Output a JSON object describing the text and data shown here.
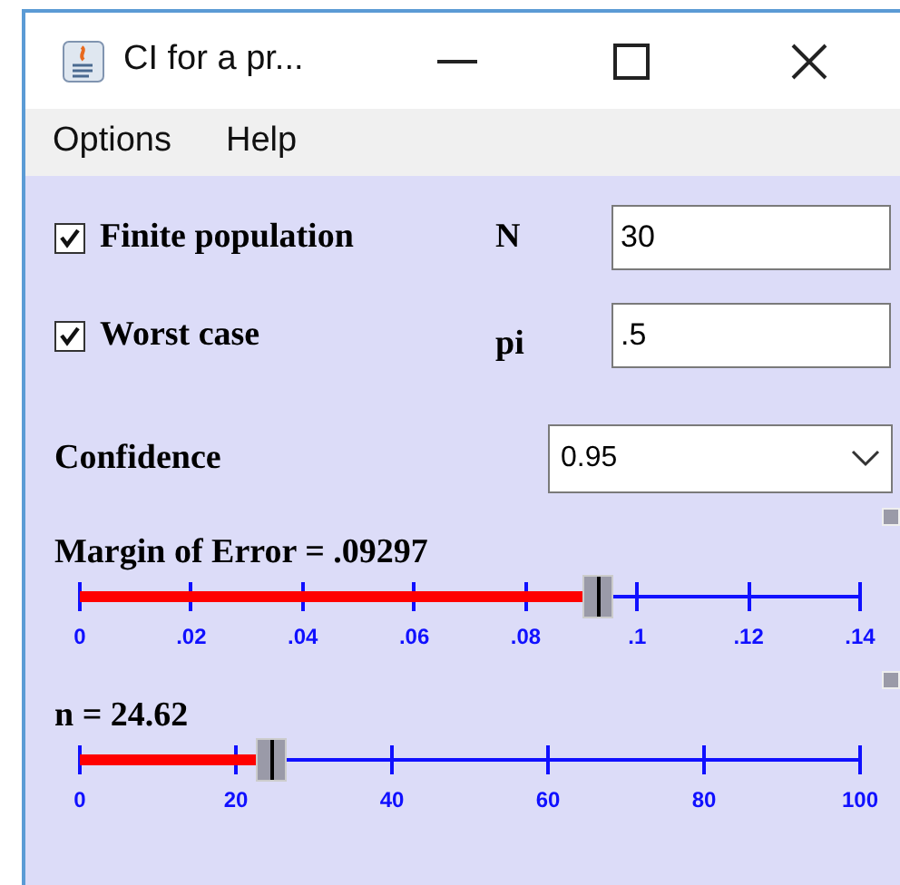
{
  "window": {
    "title": "CI for a pr..."
  },
  "menu": [
    "Options",
    "Help"
  ],
  "options": [
    {
      "label": "Finite population",
      "checked": true,
      "field_label": "N",
      "value": "30"
    },
    {
      "label": "Worst case",
      "checked": true,
      "field_label": "pi",
      "value": ".5"
    }
  ],
  "confidence": {
    "label": "Confidence",
    "value": "0.95"
  },
  "sliders": [
    {
      "label": "Margin of Error = .09297",
      "level": 0.664,
      "ticks": [
        "0",
        ".02",
        ".04",
        ".06",
        ".08",
        ".1",
        ".12",
        ".14"
      ]
    },
    {
      "label": "n = 24.62",
      "level": 0.2462,
      "ticks": [
        "0",
        "20",
        "40",
        "60",
        "80",
        "100"
      ]
    }
  ]
}
